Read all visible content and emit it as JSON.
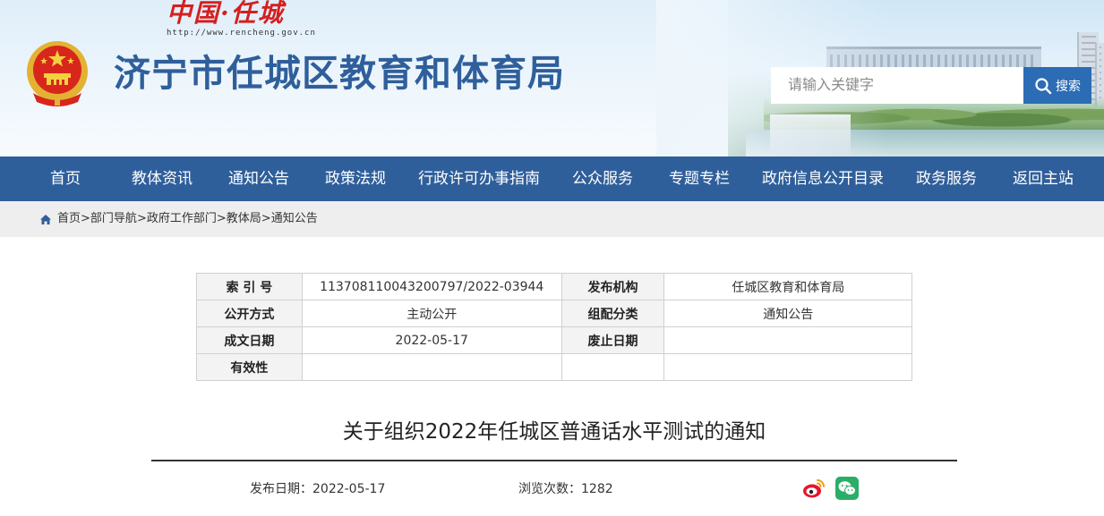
{
  "header": {
    "brand_top": "中国·任城",
    "brand_url": "http://www.rencheng.gov.cn",
    "site_title": "济宁市任城区教育和体育局",
    "emblem_icon": "national-emblem-icon",
    "search": {
      "placeholder": "请输入关键字",
      "button_label": "搜索",
      "icon": "search-icon"
    }
  },
  "nav": {
    "items": [
      {
        "label": "首页"
      },
      {
        "label": "教体资讯"
      },
      {
        "label": "通知公告"
      },
      {
        "label": "政策法规"
      },
      {
        "label": "行政许可办事指南"
      },
      {
        "label": "公众服务"
      },
      {
        "label": "专题专栏"
      },
      {
        "label": "政府信息公开目录"
      },
      {
        "label": "政务服务"
      },
      {
        "label": "返回主站"
      }
    ]
  },
  "breadcrumb": {
    "icon": "home-icon",
    "items": [
      "首页",
      "部门导航",
      "政府工作部门",
      "教体局",
      "通知公告"
    ],
    "separator": ">"
  },
  "info_table": {
    "rows": [
      {
        "label1": "索 引 号",
        "value1": "113708110043200797/2022-03944",
        "label2": "发布机构",
        "value2": "任城区教育和体育局"
      },
      {
        "label1": "公开方式",
        "value1": "主动公开",
        "label2": "组配分类",
        "value2": "通知公告"
      },
      {
        "label1": "成文日期",
        "value1": "2022-05-17",
        "label2": "废止日期",
        "value2": ""
      },
      {
        "label1": "有效性",
        "value1": "",
        "label2": "",
        "value2": ""
      }
    ]
  },
  "article": {
    "title": "关于组织2022年任城区普通话水平测试的通知",
    "publish_date": "发布日期：2022-05-17",
    "views": "浏览次数：1282",
    "share_icons": [
      "weibo-icon",
      "wechat-icon"
    ]
  },
  "colors": {
    "primary": "#2f5f9b",
    "search_button": "#2c6cb5",
    "brand_red": "#d51f1f",
    "breadcrumb_bg": "#eeeeee"
  }
}
